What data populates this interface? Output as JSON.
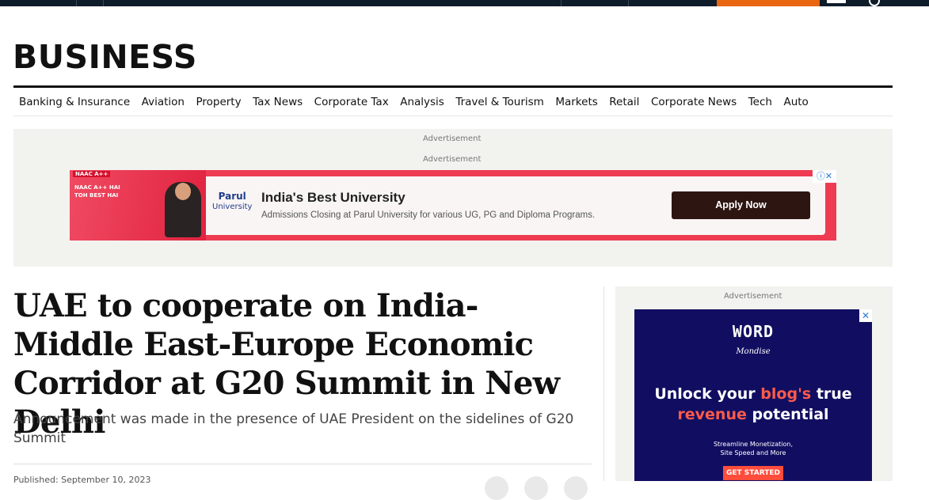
{
  "section": {
    "title": "BUSINESS"
  },
  "nav": {
    "items": [
      "Banking & Insurance",
      "Aviation",
      "Property",
      "Tax News",
      "Corporate Tax",
      "Analysis",
      "Travel & Tourism",
      "Markets",
      "Retail",
      "Corporate News",
      "Tech",
      "Auto"
    ]
  },
  "ad_top": {
    "label_1": "Advertisement",
    "label_2": "Advertisement",
    "naac": "NAAC A++",
    "left_text_1": "NAAC A++ HAI",
    "left_text_2": "TOH BEST HAI",
    "brand": "Parul",
    "brand_sub": "University",
    "headline": "India's Best University",
    "subtext": "Admissions Closing at Parul University for various UG, PG and Diploma Programs.",
    "cta": "Apply Now"
  },
  "article": {
    "headline": "UAE to cooperate on India-Middle East-Europe Economic Corridor at G20 Summit in New Delhi",
    "standfirst": "Announcement was made in the presence of UAE President on the sidelines of G20 Summit",
    "byline": "Published: September 10, 2023"
  },
  "ad_side": {
    "label": "Advertisement",
    "logo": "WORD",
    "logo_sub": "Mondise",
    "headline_1": "Unlock your ",
    "headline_hl": "blog's",
    "headline_2": " true",
    "headline_3_hl": "revenue",
    "headline_4": " potential",
    "small_1": "Streamline Monetization,",
    "small_2": "Site Speed and More",
    "cta": "GET STARTED"
  },
  "colors": {
    "topbar": "#0f1c2a",
    "accent_orange": "#e8660f",
    "ad_banner_red": "#ee3b52",
    "side_ad_navy": "#110e61"
  }
}
